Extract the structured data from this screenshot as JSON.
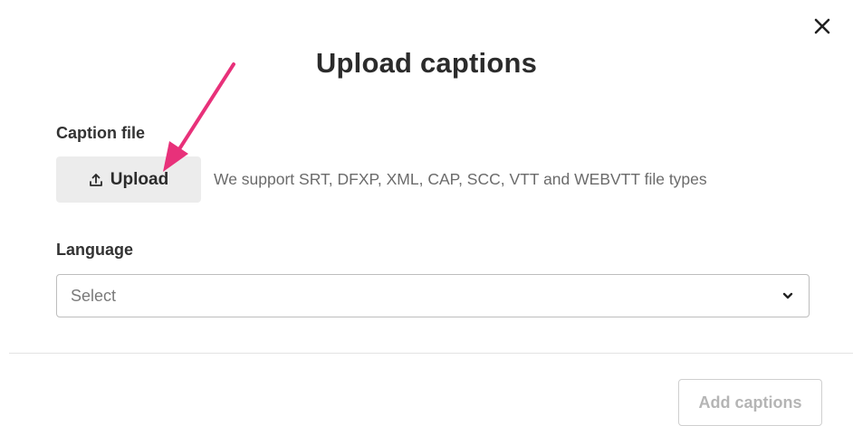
{
  "dialog": {
    "title": "Upload captions",
    "close_icon": "close-icon"
  },
  "caption_file": {
    "label": "Caption file",
    "upload_button_label": "Upload",
    "upload_icon": "upload-icon",
    "support_text": "We support SRT, DFXP, XML, CAP, SCC, VTT and WEBVTT file types"
  },
  "language": {
    "label": "Language",
    "select_value": "Select",
    "chevron_icon": "chevron-down-icon"
  },
  "footer": {
    "add_button_label": "Add captions",
    "add_button_state": "disabled"
  },
  "annotation": {
    "arrow_color": "#e8317a"
  }
}
